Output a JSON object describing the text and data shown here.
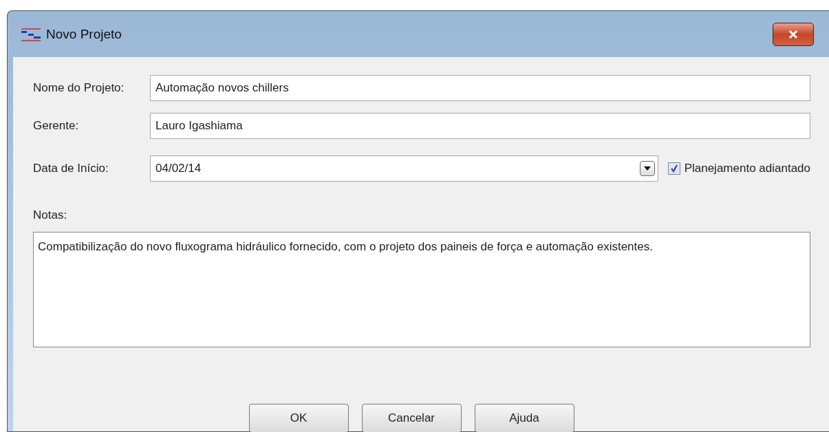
{
  "window": {
    "title": "Novo Projeto"
  },
  "fields": [
    {
      "label": "Nome do Projeto:",
      "value": "Automação novos chillers",
      "kind": "text"
    },
    {
      "label": "Gerente:",
      "value": "Lauro Igashiama",
      "kind": "text"
    },
    {
      "label": "Data de Início:",
      "value": "04/02/14",
      "kind": "date"
    }
  ],
  "checkbox": {
    "label": "Planejamento adiantado",
    "checked": true
  },
  "notes": {
    "label": "Notas:",
    "value": "Compatibilização do novo fluxograma hidráulico fornecido, com o projeto dos paineis de força e automação existentes."
  },
  "buttons": [
    "OK",
    "Cancelar",
    "Ajuda"
  ]
}
